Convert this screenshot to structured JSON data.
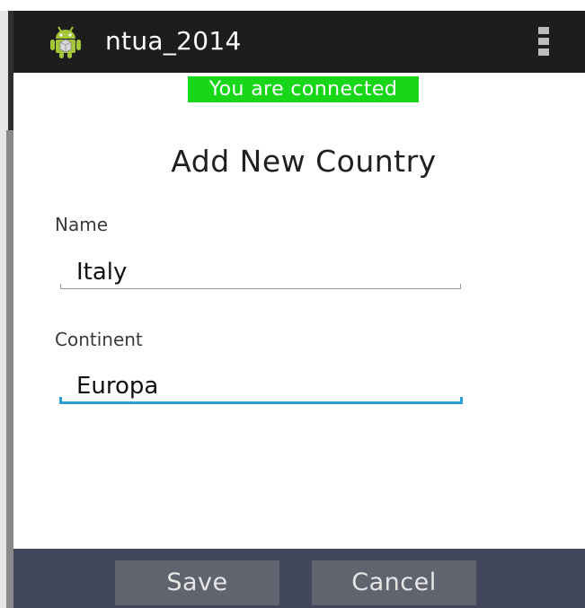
{
  "action_bar": {
    "title": "ntua_2014",
    "app_icon": "android-robot-icon",
    "menu_icon": "overflow-menu-icon"
  },
  "status": {
    "text": "You are connected",
    "color": "#18d618"
  },
  "form": {
    "title": "Add New Country",
    "name_label": "Name",
    "name_value": "Italy",
    "continent_label": "Continent",
    "continent_value": "Europa"
  },
  "buttons": {
    "save_label": "Save",
    "cancel_label": "Cancel"
  },
  "colors": {
    "action_bar": "#1d1d1d",
    "accent": "#2b9fd4",
    "button_bar": "#41465a",
    "button": "#61646f"
  }
}
